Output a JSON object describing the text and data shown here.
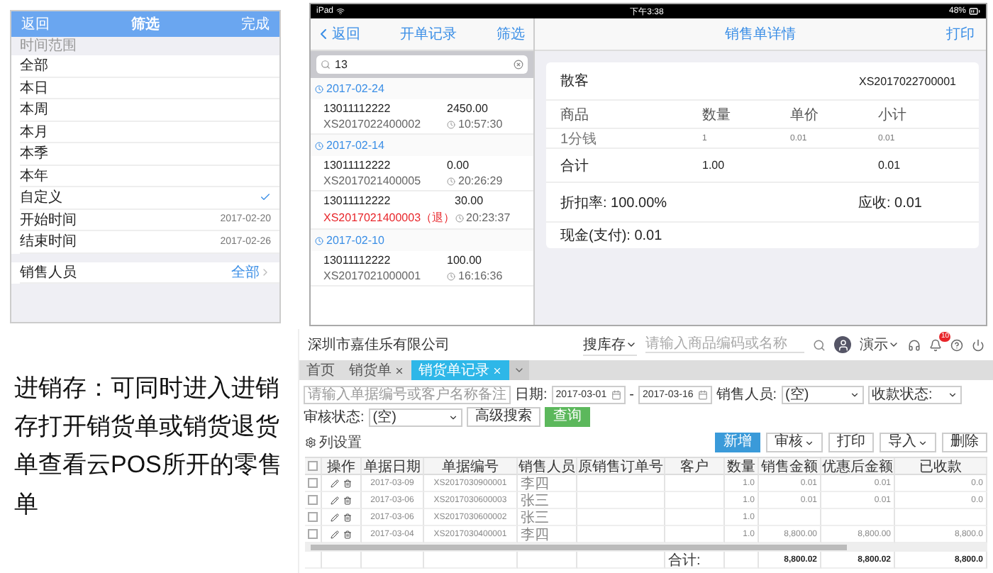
{
  "filter_panel": {
    "nav": {
      "back": "返回",
      "title": "筛选",
      "done": "完成"
    },
    "section": "时间范围",
    "options": [
      {
        "label": "全部",
        "selected": false
      },
      {
        "label": "本日",
        "selected": false
      },
      {
        "label": "本周",
        "selected": false
      },
      {
        "label": "本月",
        "selected": false
      },
      {
        "label": "本季",
        "selected": false
      },
      {
        "label": "本年",
        "selected": false
      },
      {
        "label": "自定义",
        "selected": true
      }
    ],
    "dates": [
      {
        "label": "开始时间",
        "value": "2017-02-20"
      },
      {
        "label": "结束时间",
        "value": "2017-02-26"
      }
    ],
    "salesperson": {
      "label": "销售人员",
      "value": "全部"
    }
  },
  "ipad": {
    "status_bar": {
      "device": "iPad",
      "time": "下午3:38",
      "battery": "48%"
    },
    "list_nav": {
      "back": "返回",
      "title": "开单记录",
      "filter": "筛选"
    },
    "search": {
      "value": "13"
    },
    "groups": [
      {
        "date": "2017-02-24",
        "orders": [
          {
            "phone": "13011112222",
            "amount": "2450.00",
            "number": "XS2017022400002",
            "time": "10:57:30",
            "returned": false
          }
        ]
      },
      {
        "date": "2017-02-14",
        "orders": [
          {
            "phone": "13011112222",
            "amount": "0.00",
            "number": "XS2017021400005",
            "time": "20:26:29",
            "returned": false
          },
          {
            "phone": "13011112222",
            "amount": "30.00",
            "number": "XS2017021400003（退）",
            "time": "20:23:37",
            "returned": true
          }
        ]
      },
      {
        "date": "2017-02-10",
        "orders": [
          {
            "phone": "13011112222",
            "amount": "100.00",
            "number": "XS2017021000001",
            "time": "16:16:36",
            "returned": false
          }
        ]
      }
    ],
    "detail": {
      "title": "销售单详情",
      "print": "打印",
      "customer": "散客",
      "order_no": "XS2017022700001",
      "columns": [
        "商品",
        "数量",
        "单价",
        "小计"
      ],
      "items": [
        [
          "1分钱",
          "1",
          "0.01",
          "0.01"
        ]
      ],
      "total": {
        "label": "合计",
        "quantity": "1.00",
        "subtotal": "0.01"
      },
      "discount": "折扣率: 100.00%",
      "receivable": "应收: 0.01",
      "payment": "现金(支付): 0.01"
    }
  },
  "caption": "进销存：可同时进入进销存打开销货单或销货退货单查看云POS所开的零售单",
  "web": {
    "company": "深圳市嘉佳乐有限公司",
    "search": {
      "type": "搜库存",
      "placeholder": "请输入商品编码或名称"
    },
    "user": "演示",
    "notifications": "10",
    "tabs": [
      {
        "label": "首页",
        "selected": false,
        "closable": false
      },
      {
        "label": "销货单",
        "selected": false,
        "closable": true
      },
      {
        "label": "销货单记录",
        "selected": true,
        "closable": true
      }
    ],
    "filters": {
      "keyword_placeholder": "请输入单据编号或客户名称备注",
      "date_label": "日期:",
      "date_from": "2017-03-01",
      "range_separator": "-",
      "date_to": "2017-03-16",
      "salesperson_label": "销售人员:",
      "salesperson": "(空)",
      "payment_status": "收款状态:",
      "review_label": "审核状态:",
      "review": "(空)",
      "advanced": "高级搜索",
      "query": "查询"
    },
    "toolbar": {
      "column_settings": "列设置",
      "buttons": [
        {
          "label": "新增",
          "kind": "primary"
        },
        {
          "label": "审核",
          "kind": "menu"
        },
        {
          "label": "打印",
          "kind": "plain"
        },
        {
          "label": "导入",
          "kind": "menu"
        },
        {
          "label": "删除",
          "kind": "plain"
        }
      ]
    },
    "table": {
      "columns": [
        "操作",
        "单据日期",
        "单据编号",
        "销售人员",
        "原销售订单号",
        "客户",
        "数量",
        "销售金额",
        "优惠后金额",
        "已收款"
      ],
      "select_all_checked": false,
      "rows": [
        {
          "checked": false,
          "date": "2017-03-09",
          "number": "XS2017030900001",
          "salesperson": "李四",
          "quantity": "1.0",
          "amount": "0.01",
          "discounted": "0.01",
          "received": "0.0"
        },
        {
          "checked": false,
          "date": "2017-03-06",
          "number": "XS2017030600003",
          "salesperson": "张三",
          "quantity": "1.0",
          "amount": "0.01",
          "discounted": "0.01",
          "received": "0.0"
        },
        {
          "checked": false,
          "date": "2017-03-06",
          "number": "XS2017030600002",
          "salesperson": "张三",
          "quantity": "1.0"
        },
        {
          "checked": false,
          "date": "2017-03-04",
          "number": "XS2017030400001",
          "salesperson": "李四",
          "quantity": "1.0",
          "amount": "8,800.00",
          "discounted": "8,800.00",
          "received": "8,800.0"
        }
      ],
      "totals_label": "合计:",
      "totals": [
        "8,800.02",
        "8,800.02",
        "8,800.0"
      ]
    }
  }
}
